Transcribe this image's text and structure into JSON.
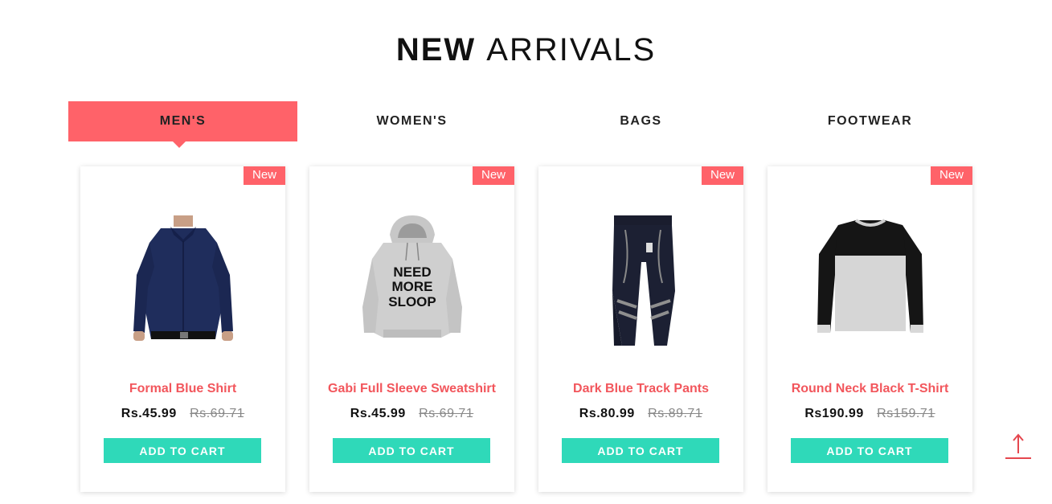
{
  "heading": {
    "bold": "NEW",
    "light": "ARRIVALS"
  },
  "tabs": [
    {
      "label": "MEN'S",
      "active": true
    },
    {
      "label": "WOMEN'S",
      "active": false
    },
    {
      "label": "BAGS",
      "active": false
    },
    {
      "label": "FOOTWEAR",
      "active": false
    }
  ],
  "products": [
    {
      "badge": "New",
      "name": "Formal Blue Shirt",
      "price": "Rs.45.99",
      "old_price": "Rs.69.71",
      "button": "ADD TO CART",
      "image": "shirt-image"
    },
    {
      "badge": "New",
      "name": "Gabi Full Sleeve Sweatshirt",
      "price": "Rs.45.99",
      "old_price": "Rs.69.71",
      "button": "ADD TO CART",
      "image": "sweatshirt-image",
      "print_text": [
        "NEED",
        "MORE",
        "SLOOP"
      ]
    },
    {
      "badge": "New",
      "name": "Dark Blue Track Pants",
      "price": "Rs.80.99",
      "old_price": "Rs.89.71",
      "button": "ADD TO CART",
      "image": "track-pants-image"
    },
    {
      "badge": "New",
      "name": "Round Neck Black T-Shirt",
      "price": "Rs190.99",
      "old_price": "Rs159.71",
      "button": "ADD TO CART",
      "image": "tshirt-image"
    }
  ],
  "scroll_top": {
    "icon": "arrow-up-icon"
  },
  "colors": {
    "accent": "#ff6269",
    "product_name": "#f2565c",
    "cart_button": "#2fd9b9"
  }
}
